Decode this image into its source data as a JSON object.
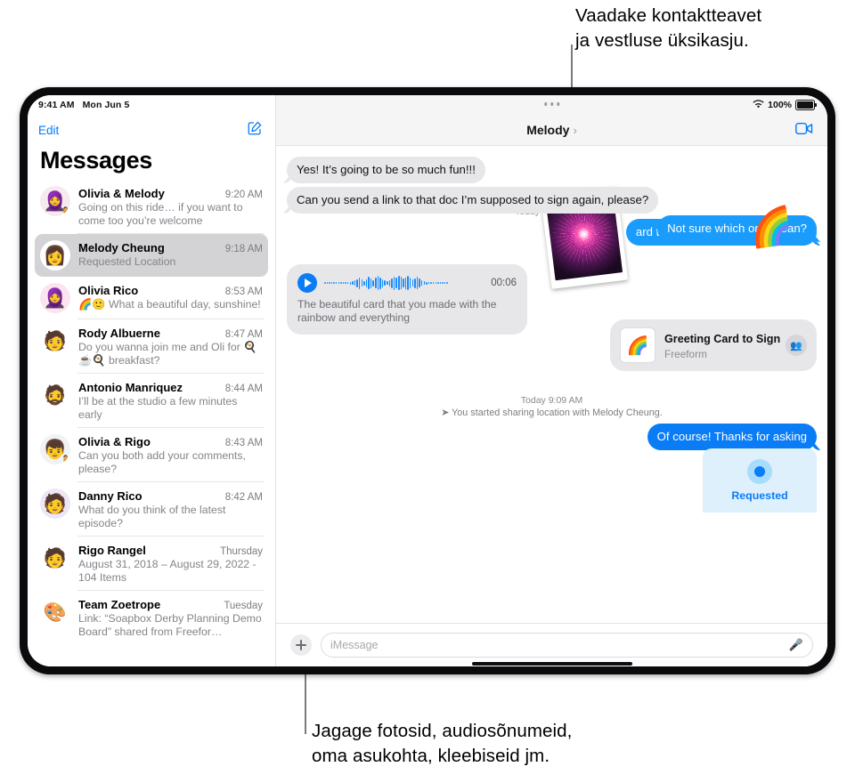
{
  "callouts": {
    "top": "Vaadake kontaktteavet\nja vestluse üksikasju.",
    "bottom": "Jagage fotosid, audiosõnumeid,\noma asukohta, kleebiseid jm."
  },
  "statusbar": {
    "time": "9:41 AM",
    "date": "Mon Jun 5",
    "battery_percent": "100%",
    "wifi_icon": "wifi-icon",
    "battery_icon": "battery-icon"
  },
  "sidebar": {
    "edit_label": "Edit",
    "compose_icon": "compose-icon",
    "title": "Messages",
    "conversations": [
      {
        "name": "Olivia & Melody",
        "time": "9:20 AM",
        "preview": "Going on this ride… if you want to come too you’re welcome",
        "avatar": "🧕",
        "badge": "🧍",
        "avatar_bg": "#f7e9f0",
        "selected": false
      },
      {
        "name": "Melody Cheung",
        "time": "9:18 AM",
        "preview": "Requested Location",
        "avatar": "👩",
        "badge": "",
        "avatar_bg": "#ffffff",
        "selected": true
      },
      {
        "name": "Olivia Rico",
        "time": "8:53 AM",
        "preview": "🌈🙂 What a beautiful day, sunshine!",
        "avatar": "🧕",
        "badge": "",
        "avatar_bg": "#fbe3ef",
        "selected": false
      },
      {
        "name": "Rody Albuerne",
        "time": "8:47 AM",
        "preview": "Do you wanna join me and Oli for 🍳☕🍳 breakfast?",
        "avatar": "🧑",
        "badge": "",
        "avatar_bg": "#ffffff",
        "selected": false
      },
      {
        "name": "Antonio Manriquez",
        "time": "8:44 AM",
        "preview": "I’ll be at the studio a few minutes early",
        "avatar": "🧔",
        "badge": "",
        "avatar_bg": "#ffffff",
        "selected": false
      },
      {
        "name": "Olivia & Rigo",
        "time": "8:43 AM",
        "preview": "Can you both add your comments, please?",
        "avatar": "👦",
        "badge": "🧍",
        "avatar_bg": "#f2f2f4",
        "selected": false
      },
      {
        "name": "Danny Rico",
        "time": "8:42 AM",
        "preview": "What do you think of the latest episode?",
        "avatar": "🧑",
        "badge": "",
        "avatar_bg": "#ece6f7",
        "selected": false
      },
      {
        "name": "Rigo Rangel",
        "time": "Thursday",
        "preview": "August 31, 2018 – August 29, 2022 - 104 Items",
        "avatar": "🧑",
        "badge": "",
        "avatar_bg": "#ffffff",
        "selected": false
      },
      {
        "name": "Team Zoetrope",
        "time": "Tuesday",
        "preview": "Link: “Soapbox Derby Planning Demo Board” shared from Freefor…",
        "avatar": "🎨",
        "badge": "",
        "avatar_bg": "#ffffff",
        "selected": false
      }
    ]
  },
  "conversation": {
    "title": "Melody",
    "chevron_icon": "chevron-right-icon",
    "facetime_icon": "facetime-video-icon",
    "multitask_icon": "multitask-dots-icon",
    "day_label": "Today",
    "photo_sticker_alt": "fireworks-photo-sticker",
    "rainbow_sticker": "🌈",
    "messages": [
      {
        "text": "ard to seeing you tomorrow night",
        "underlined": "tomorrow night",
        "side": "out"
      },
      {
        "text": "Yes! It’s going to be so much fun!!!",
        "side": "in"
      },
      {
        "text": "Can you send a link to that doc I’m supposed to sign again, please?",
        "side": "in"
      },
      {
        "text": "Not sure which one      mean?",
        "side": "out"
      },
      {
        "text": "Of course! Thanks for asking",
        "side": "out"
      }
    ],
    "audio": {
      "play_icon": "play-icon",
      "duration": "00:06",
      "transcript": "The beautiful card that you made with the rainbow and everything"
    },
    "card": {
      "title": "Greeting Card to Sign",
      "subtitle": "Freeform",
      "thumb_icon": "greeting-card-thumbnail",
      "people_icon": "people-icon"
    },
    "location_status": {
      "time": "Today 9:09 AM",
      "text": "You started sharing location with Melody Cheung.",
      "arrow_icon": "location-arrow-icon"
    },
    "requested": {
      "label": "Requested",
      "icon": "location-dot-icon"
    }
  },
  "compose": {
    "plus_icon": "plus-icon",
    "placeholder": "iMessage",
    "mic_icon": "microphone-icon"
  },
  "colors": {
    "accent": "#007aff",
    "bubble_out": "#1a9cfc",
    "bubble_in": "#e7e7ea",
    "requested_bg": "#dff0fd"
  }
}
